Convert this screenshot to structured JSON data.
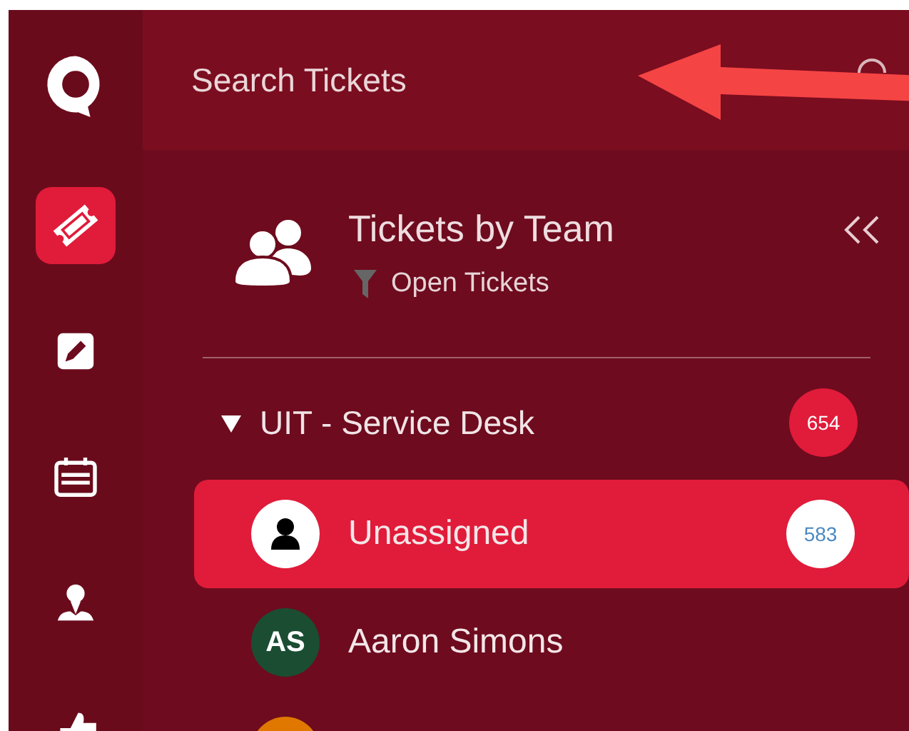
{
  "search": {
    "placeholder": "Search Tickets"
  },
  "nav": [
    {
      "kind": "tickets",
      "selected": true
    },
    {
      "kind": "edit",
      "selected": false
    },
    {
      "kind": "calendar",
      "selected": false
    },
    {
      "kind": "person",
      "selected": false
    },
    {
      "kind": "thumb",
      "selected": false
    }
  ],
  "panel": {
    "title": "Tickets by Team",
    "filter": "Open Tickets"
  },
  "groups": [
    {
      "name": "UIT - Service Desk",
      "count": "654",
      "expanded": true,
      "children": [
        {
          "kind": "unassigned",
          "name": "Unassigned",
          "count": "583",
          "selected": true
        },
        {
          "kind": "person",
          "name": "Aaron Simons",
          "initials": "AS",
          "color": "#1b4d33",
          "selected": false
        },
        {
          "kind": "person",
          "color": "#e07800",
          "selected": false
        }
      ]
    }
  ]
}
